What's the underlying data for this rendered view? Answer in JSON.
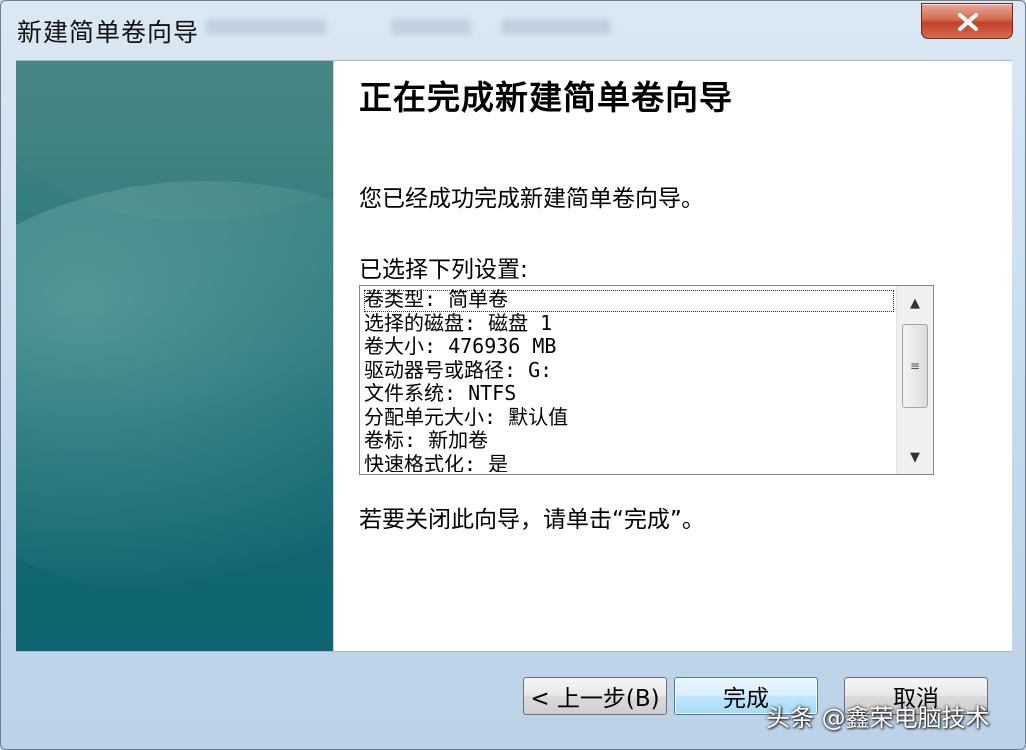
{
  "window": {
    "title": "新建简单卷向导"
  },
  "page": {
    "heading": "正在完成新建简单卷向导",
    "message": "您已经成功完成新建简单卷向导。",
    "settings_label": "已选择下列设置:",
    "settings": [
      "卷类型: 简单卷",
      "选择的磁盘: 磁盘 1",
      "卷大小: 476936 MB",
      "驱动器号或路径: G:",
      "文件系统: NTFS",
      "分配单元大小: 默认值",
      "卷标: 新加卷",
      "快速格式化: 是"
    ],
    "close_hint": "若要关闭此向导，请单击“完成”。"
  },
  "buttons": {
    "back": "< 上一步(B)",
    "finish": "完成",
    "cancel": "取消"
  },
  "watermark": "头条 @鑫荣电脑技术",
  "icons": {
    "close": "close-icon",
    "scroll_up": "scroll-up-arrow-icon",
    "scroll_down": "scroll-down-arrow-icon",
    "grip": "grip-icon"
  },
  "colors": {
    "sidebar": "#176b72",
    "close_button": "#c0412a",
    "primary_button_border": "#3c7fb1"
  }
}
